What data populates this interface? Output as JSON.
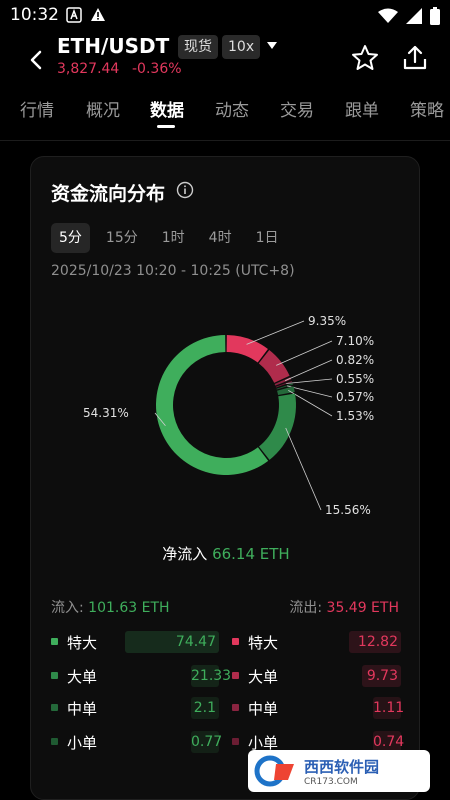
{
  "status_bar": {
    "time": "10:32"
  },
  "header": {
    "pair": "ETH/USDT",
    "spot_tag": "现货",
    "leverage_tag": "10x",
    "price": "3,827.44",
    "change": "-0.36%"
  },
  "tabs": [
    "行情",
    "概况",
    "数据",
    "动态",
    "交易",
    "跟单",
    "策略"
  ],
  "active_tab": "数据",
  "card": {
    "title": "资金流向分布",
    "intervals": [
      "5分",
      "15分",
      "1时",
      "4时",
      "1日"
    ],
    "active_interval": "5分",
    "time_range": "2025/10/23 10:20 - 10:25 (UTC+8)",
    "net_inflow_label": "净流入",
    "net_inflow_value": "66.14 ETH",
    "inflow_label": "流入:",
    "inflow_value": "101.63 ETH",
    "outflow_label": "流出:",
    "outflow_value": "35.49 ETH"
  },
  "chart_data": {
    "type": "pie",
    "title": "资金流向分布",
    "slices": [
      {
        "label": "9.35%",
        "value": 9.35,
        "color": "#e2385d"
      },
      {
        "label": "7.10%",
        "value": 7.1,
        "color": "#b02c4c"
      },
      {
        "label": "0.82%",
        "value": 0.82,
        "color": "#8a2440"
      },
      {
        "label": "0.55%",
        "value": 0.55,
        "color": "#6b1d33"
      },
      {
        "label": "0.57%",
        "value": 0.57,
        "color": "#1f5a32"
      },
      {
        "label": "1.53%",
        "value": 1.53,
        "color": "#24693a"
      },
      {
        "label": "15.56%",
        "value": 15.56,
        "color": "#2f8a4a"
      },
      {
        "label": "54.31%",
        "value": 54.31,
        "color": "#3fae5c"
      }
    ]
  },
  "breakdown": {
    "inflow": [
      {
        "label": "特大",
        "value": "74.47",
        "share": 0.733,
        "color": "#3fae5c"
      },
      {
        "label": "大单",
        "value": "21.33",
        "share": 0.21,
        "color": "#2f8a4a"
      },
      {
        "label": "中单",
        "value": "2.1",
        "share": 0.021,
        "color": "#24693a"
      },
      {
        "label": "小单",
        "value": "0.77",
        "share": 0.008,
        "color": "#1f5a32"
      }
    ],
    "outflow": [
      {
        "label": "特大",
        "value": "12.82",
        "share": 0.361,
        "color": "#e2385d"
      },
      {
        "label": "大单",
        "value": "9.73",
        "share": 0.274,
        "color": "#b02c4c"
      },
      {
        "label": "中单",
        "value": "1.11",
        "share": 0.031,
        "color": "#8a2440"
      },
      {
        "label": "小单",
        "value": "0.74",
        "share": 0.021,
        "color": "#6b1d33"
      }
    ]
  },
  "watermark": {
    "brand": "西西软件园",
    "url": "CR173.COM"
  }
}
